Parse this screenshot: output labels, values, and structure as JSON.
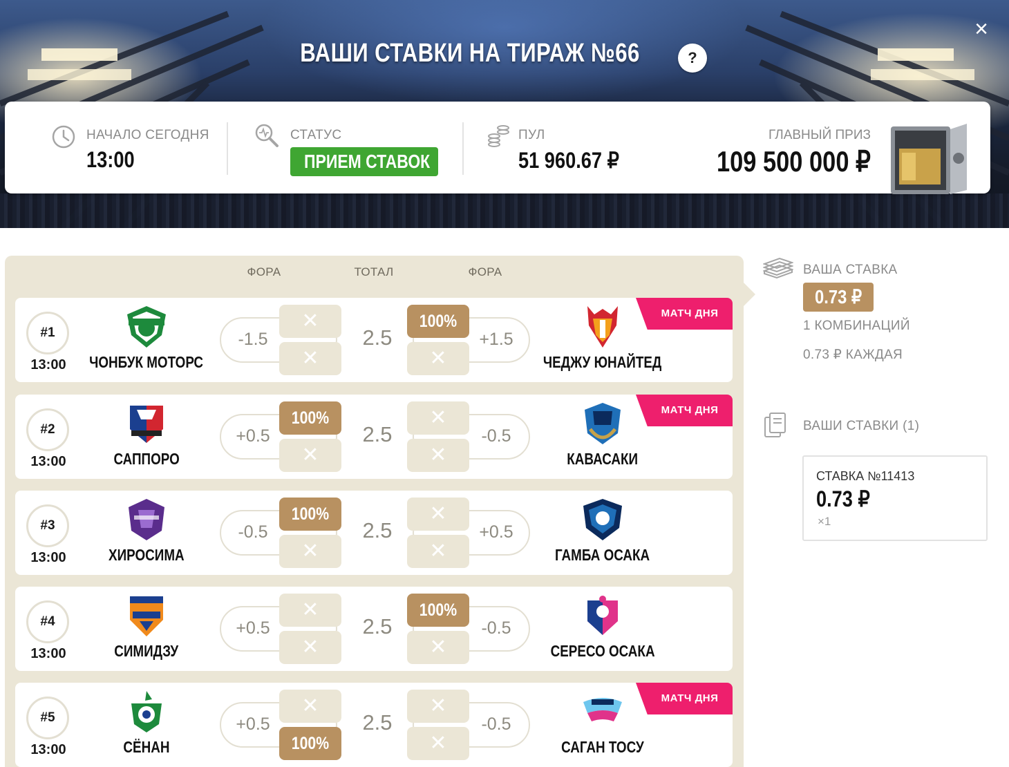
{
  "header": {
    "title": "ВАШИ СТАВКИ НА ТИРАЖ №66",
    "help_label": "?",
    "close_label": "×"
  },
  "info": {
    "start_label": "НАЧАЛО СЕГОДНЯ",
    "start_time": "13:00",
    "status_label": "СТАТУС",
    "status_value": "ПРИЕМ СТАВОК",
    "pool_label": "ПУЛ",
    "pool_value": "51 960.67 ₽",
    "prize_label": "ГЛАВНЫЙ ПРИЗ",
    "prize_value": "109 500 000 ₽"
  },
  "columns": {
    "fora_left": "ФОРА",
    "total": "ТОТАЛ",
    "fora_right": "ФОРА"
  },
  "match_day_label": "МАТЧ ДНЯ",
  "cross": "✕",
  "matches": [
    {
      "num": "#1",
      "time": "13:00",
      "home": "ЧОНБУК МОТОРС",
      "away": "ЧЕДЖУ ЮНАЙТЕД",
      "fora_home": "-1.5",
      "total": "2.5",
      "fora_away": "+1.5",
      "match_of_day": true,
      "selections": {
        "left_top": "",
        "left_bottom": "",
        "right_top": "100%",
        "right_bottom": ""
      }
    },
    {
      "num": "#2",
      "time": "13:00",
      "home": "САППОРО",
      "away": "КАВАСАКИ",
      "fora_home": "+0.5",
      "total": "2.5",
      "fora_away": "-0.5",
      "match_of_day": true,
      "selections": {
        "left_top": "100%",
        "left_bottom": "",
        "right_top": "",
        "right_bottom": ""
      }
    },
    {
      "num": "#3",
      "time": "13:00",
      "home": "ХИРОСИМА",
      "away": "ГАМБА ОСАКА",
      "fora_home": "-0.5",
      "total": "2.5",
      "fora_away": "+0.5",
      "match_of_day": false,
      "selections": {
        "left_top": "100%",
        "left_bottom": "",
        "right_top": "",
        "right_bottom": ""
      }
    },
    {
      "num": "#4",
      "time": "13:00",
      "home": "СИМИДЗУ",
      "away": "СЕРЕСО ОСАКА",
      "fora_home": "+0.5",
      "total": "2.5",
      "fora_away": "-0.5",
      "match_of_day": false,
      "selections": {
        "left_top": "",
        "left_bottom": "",
        "right_top": "100%",
        "right_bottom": ""
      }
    },
    {
      "num": "#5",
      "time": "13:00",
      "home": "СЁНАН",
      "away": "САГАН ТОСУ",
      "fora_home": "+0.5",
      "total": "2.5",
      "fora_away": "-0.5",
      "match_of_day": true,
      "selections": {
        "left_top": "",
        "left_bottom": "100%",
        "right_top": "",
        "right_bottom": ""
      }
    }
  ],
  "sidebar": {
    "your_stake_label": "ВАША СТАВКА",
    "stake_amount": "0.73 ₽",
    "combinations": "1 КОМБИНАЦИЙ",
    "each": "0.73 ₽ КАЖДАЯ",
    "your_bets_label": "ВАШИ СТАВКИ (1)",
    "bet_card": {
      "title": "СТАВКА №11413",
      "amount": "0.73 ₽",
      "multiplier": "×1"
    }
  },
  "colors": {
    "accent_gold": "#b89161",
    "status_green": "#3fa632",
    "match_day_pink": "#ee1f6d",
    "panel_beige": "#ebe6d6"
  }
}
